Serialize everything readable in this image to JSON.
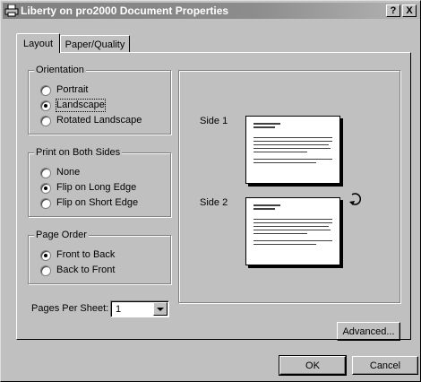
{
  "window": {
    "title": "Liberty on pro2000 Document Properties",
    "help_button": "?",
    "close_button": "X"
  },
  "tabs": [
    {
      "label": "Layout",
      "selected": true
    },
    {
      "label": "Paper/Quality",
      "selected": false
    }
  ],
  "orientation": {
    "label": "Orientation",
    "options": [
      {
        "label": "Portrait",
        "checked": false
      },
      {
        "label": "Landscape",
        "checked": true
      },
      {
        "label": "Rotated Landscape",
        "checked": false
      }
    ]
  },
  "duplex": {
    "label": "Print on Both Sides",
    "options": [
      {
        "label": "None",
        "checked": false
      },
      {
        "label": "Flip on Long Edge",
        "checked": true
      },
      {
        "label": "Flip on Short Edge",
        "checked": false
      }
    ]
  },
  "page_order": {
    "label": "Page Order",
    "options": [
      {
        "label": "Front to Back",
        "checked": true
      },
      {
        "label": "Back to Front",
        "checked": false
      }
    ]
  },
  "pages_per_sheet": {
    "label": "Pages Per Sheet:",
    "value": "1"
  },
  "preview": {
    "side1_label": "Side 1",
    "side2_label": "Side 2"
  },
  "buttons": {
    "advanced": "Advanced...",
    "ok": "OK",
    "cancel": "Cancel"
  },
  "colors": {
    "face": "#c0c0c0",
    "title_bar": "#808080"
  }
}
